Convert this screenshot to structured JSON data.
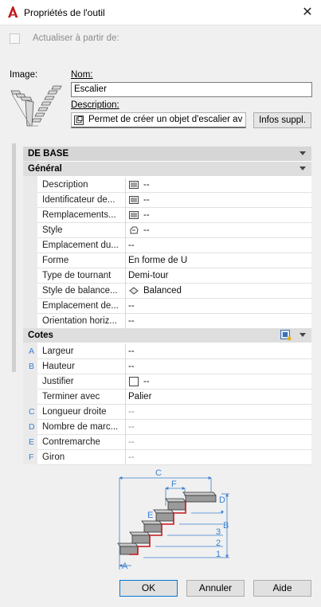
{
  "window": {
    "title": "Propriétés de l'outil",
    "close_glyph": "✕"
  },
  "header": {
    "refresh_label": "Actualiser à partir de:",
    "image_label": "Image:",
    "name_label": "Nom:",
    "name_value": "Escalier",
    "description_label": "Description:",
    "description_value": "Permet de créer un objet d'escalier av",
    "info_button": "Infos suppl."
  },
  "grid": {
    "section_base": "DE BASE",
    "section_general": "Général",
    "general_rows": [
      {
        "name": "Description",
        "value": "--",
        "icon": "list-icon"
      },
      {
        "name": "Identificateur de...",
        "value": "--",
        "icon": "list-icon"
      },
      {
        "name": "Remplacements...",
        "value": "--",
        "icon": "list-icon"
      },
      {
        "name": "Style",
        "value": "--",
        "icon": "style-icon"
      },
      {
        "name": "Emplacement du...",
        "value": "--"
      },
      {
        "name": "Forme",
        "value": "En forme de U"
      },
      {
        "name": "Type de tournant",
        "value": "Demi-tour"
      },
      {
        "name": "Style de balance...",
        "value": "Balanced",
        "icon": "balance-icon"
      },
      {
        "name": "Emplacement de...",
        "value": "--"
      },
      {
        "name": "Orientation horiz...",
        "value": "--"
      }
    ],
    "section_cotes": "Cotes",
    "cotes_rows": [
      {
        "letter": "A",
        "name": "Largeur",
        "value": "--"
      },
      {
        "letter": "B",
        "name": "Hauteur",
        "value": "--"
      },
      {
        "letter": "",
        "name": "Justifier",
        "value": "--",
        "icon": "justify-icon"
      },
      {
        "letter": "",
        "name": "Terminer avec",
        "value": "Palier"
      },
      {
        "letter": "C",
        "name": "Longueur droite",
        "value": "--"
      },
      {
        "letter": "D",
        "name": "Nombre de marc...",
        "value": "--"
      },
      {
        "letter": "E",
        "name": "Contremarche",
        "value": "--"
      },
      {
        "letter": "F",
        "name": "Giron",
        "value": "--"
      }
    ]
  },
  "diagram": {
    "labels": [
      "A",
      "B",
      "C",
      "D",
      "E",
      "F",
      "1",
      "2",
      "3",
      "•"
    ]
  },
  "buttons": {
    "ok": "OK",
    "cancel": "Annuler",
    "help": "Aide"
  },
  "colors": {
    "accent": "#0078d7",
    "letter": "#3b7fd0",
    "autocad_red": "#c4161c"
  }
}
